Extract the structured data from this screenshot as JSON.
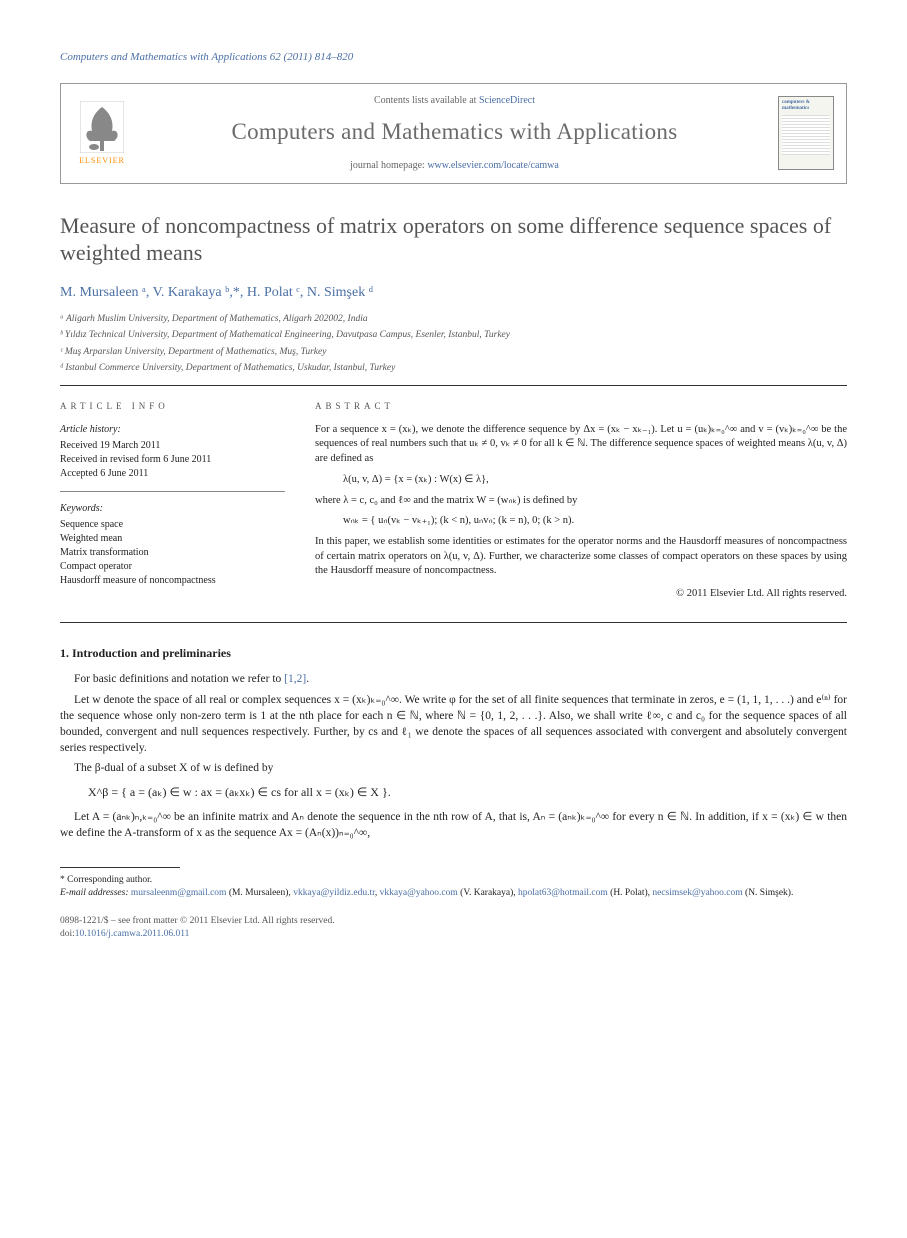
{
  "citation": "Computers and Mathematics with Applications 62 (2011) 814–820",
  "header": {
    "publisher": "ELSEVIER",
    "contents_prefix": "Contents lists available at ",
    "contents_link": "ScienceDirect",
    "journal": "Computers and Mathematics with Applications",
    "homepage_prefix": "journal homepage: ",
    "homepage_link": "www.elsevier.com/locate/camwa",
    "cover_text": "computers & mathematics"
  },
  "title": "Measure of noncompactness of matrix operators on some difference sequence spaces of weighted means",
  "authors_html": "M. Mursaleen ᵃ, V. Karakaya ᵇ,*, H. Polat ᶜ, N. Simşek ᵈ",
  "affiliations": [
    "ᵃ Aligarh Muslim University, Department of Mathematics, Aligarh 202002, India",
    "ᵇ Yıldız Technical University, Department of Mathematical Engineering, Davutpasa Campus, Esenler, Istanbul, Turkey",
    "ᶜ Muş Arparslan University, Department of Mathematics, Muş, Turkey",
    "ᵈ Istanbul Commerce University, Department of Mathematics, Uskudar, Istanbul, Turkey"
  ],
  "info_label": "ARTICLE INFO",
  "abstract_label": "ABSTRACT",
  "history": {
    "head": "Article history:",
    "lines": [
      "Received 19 March 2011",
      "Received in revised form 6 June 2011",
      "Accepted 6 June 2011"
    ]
  },
  "keywords": {
    "head": "Keywords:",
    "items": [
      "Sequence space",
      "Weighted mean",
      "Matrix transformation",
      "Compact operator",
      "Hausdorff measure of noncompactness"
    ]
  },
  "abstract": {
    "p1": "For a sequence x = (xₖ), we denote the difference sequence by Δx = (xₖ − xₖ₋₁). Let u = (uₖ)ₖ₌₀^∞ and v = (vₖ)ₖ₌₀^∞ be the sequences of real numbers such that uₖ ≠ 0, vₖ ≠ 0 for all k ∈ ℕ. The difference sequence spaces of weighted means λ(u, v, Δ) are defined as",
    "eq1": "λ(u, v, Δ) = {x = (xₖ) : W(x) ∈ λ},",
    "p2": "where λ = c, c₀ and ℓ∞ and the matrix W = (wₙₖ) is defined by",
    "eq2": "wₙₖ = { uₙ(vₖ − vₖ₊₁);  (k < n),   uₙvₙ;  (k = n),   0;  (k > n).",
    "p3": "In this paper, we establish some identities or estimates for the operator norms and the Hausdorff measures of noncompactness of certain matrix operators on λ(u, v, Δ). Further, we characterize some classes of compact operators on these spaces by using the Hausdorff measure of noncompactness.",
    "copyright": "© 2011 Elsevier Ltd. All rights reserved."
  },
  "section1": {
    "heading": "1. Introduction and preliminaries",
    "p1_a": "For basic definitions and notation we refer to ",
    "p1_refs": "[1,2]",
    "p1_b": ".",
    "p2": "Let w denote the space of all real or complex sequences x = (xₖ)ₖ₌₀^∞. We write φ for the set of all finite sequences that terminate in zeros, e = (1, 1, 1, . . .) and e⁽ⁿ⁾ for the sequence whose only non-zero term is 1 at the nth place for each n ∈ ℕ, where ℕ = {0, 1, 2, . . .}. Also, we shall write ℓ∞, c and c₀ for the sequence spaces of all bounded, convergent and null sequences respectively. Further, by cs and ℓ₁ we denote the spaces of all sequences associated with convergent and absolutely convergent series respectively.",
    "p3": "The β-dual of a subset X of w is defined by",
    "eq": "X^β = { a = (aₖ) ∈ w : ax = (aₖxₖ) ∈ cs for all x = (xₖ) ∈ X }.",
    "p4": "Let A = (aₙₖ)ₙ,ₖ₌₀^∞ be an infinite matrix and Aₙ denote the sequence in the nth row of A, that is, Aₙ = (aₙₖ)ₖ₌₀^∞ for every n ∈ ℕ. In addition, if x = (xₖ) ∈ w then we define the A-transform of x as the sequence Ax = (Aₙ(x))ₙ₌₀^∞,"
  },
  "footnotes": {
    "corr": "* Corresponding author.",
    "emails_label": "E-mail addresses: ",
    "emails": [
      {
        "addr": "mursaleenm@gmail.com",
        "who": " (M. Mursaleen), "
      },
      {
        "addr": "vkkaya@yildiz.edu.tr",
        "who": ", "
      },
      {
        "addr": "vkkaya@yahoo.com",
        "who": " (V. Karakaya), "
      },
      {
        "addr": "hpolat63@hotmail.com",
        "who": " (H. Polat), "
      },
      {
        "addr": "necsimsek@yahoo.com",
        "who": " (N. Simşek)."
      }
    ]
  },
  "footer": {
    "line1": "0898-1221/$ – see front matter © 2011 Elsevier Ltd. All rights reserved.",
    "doi_label": "doi:",
    "doi": "10.1016/j.camwa.2011.06.011"
  }
}
